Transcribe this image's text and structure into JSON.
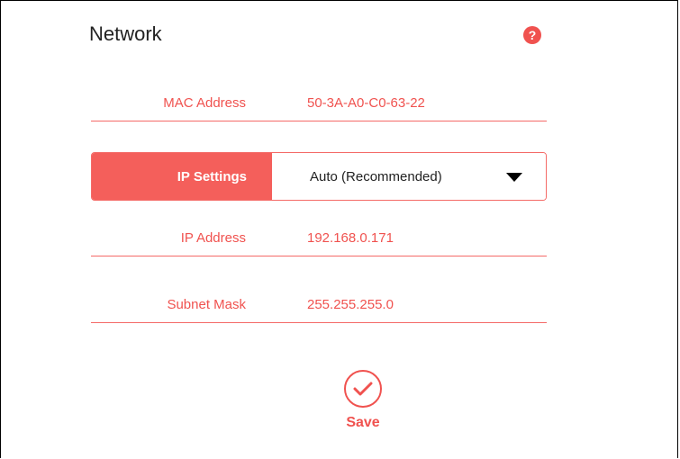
{
  "page": {
    "title": "Network",
    "help_icon": "question-circle-icon",
    "help_glyph": "?"
  },
  "mac": {
    "label": "MAC Address",
    "value": "50-3A-A0-C0-63-22"
  },
  "ip_settings": {
    "label": "IP Settings",
    "selected": "Auto (Recommended)"
  },
  "ip": {
    "label": "IP Address",
    "value": "192.168.0.171"
  },
  "subnet": {
    "label": "Subnet Mask",
    "value": "255.255.255.0"
  },
  "save": {
    "label": "Save",
    "icon": "checkmark-circle-icon"
  },
  "colors": {
    "accent": "#f0524f",
    "accent_fill": "#f45f5b",
    "divider": "#f46a67"
  }
}
